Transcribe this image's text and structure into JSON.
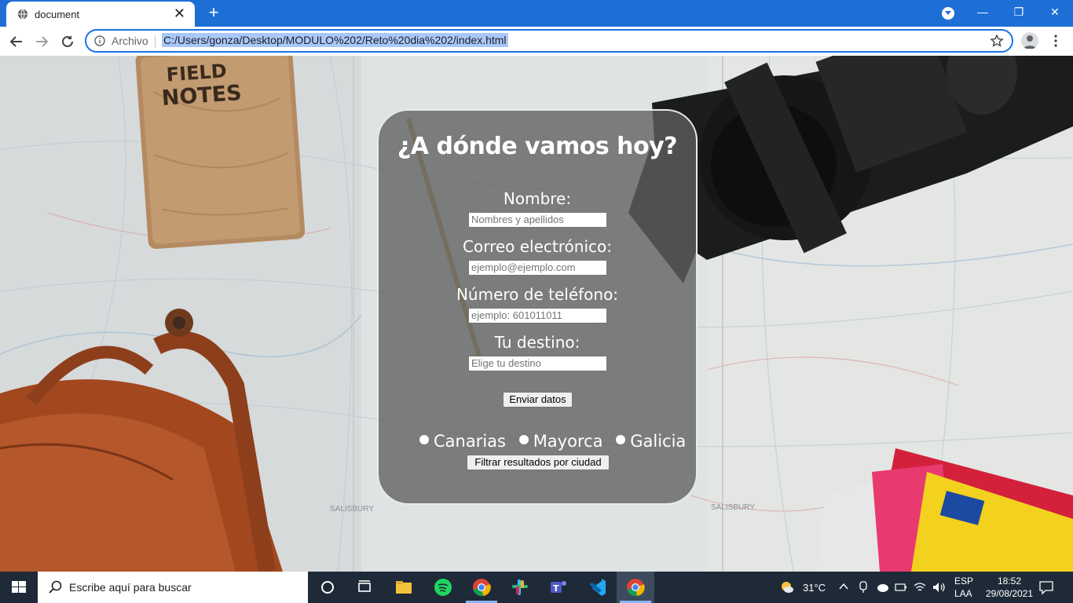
{
  "browser": {
    "tab_title": "document",
    "tab_close": "✕",
    "new_tab": "+",
    "minimize": "—",
    "restore": "❐",
    "close": "✕",
    "scheme_label": "Archivo",
    "url": "C:/Users/gonza/Desktop/MODULO%202/Reto%20dia%202/index.html",
    "accent_color": "#1d6fd6"
  },
  "form": {
    "title": "¿A dónde vamos hoy?",
    "name_label": "Nombre:",
    "name_placeholder": "Nombres y apellidos",
    "email_label": "Correo electrónico:",
    "email_placeholder": "ejemplo@ejemplo.com",
    "phone_label": "Número de teléfono:",
    "phone_placeholder": "ejemplo: 601011011",
    "destination_label": "Tu destino:",
    "destination_placeholder": "Elige tu destino",
    "submit_label": "Enviar datos",
    "cities": [
      "Canarias",
      "Mayorca",
      "Galicia"
    ],
    "filter_label": "Filtrar resultados por ciudad"
  },
  "background": {
    "notebook_line1": "FIELD",
    "notebook_line2": "NOTES",
    "map_label": "SALISBURY"
  },
  "taskbar": {
    "search_placeholder": "Escribe aquí para buscar",
    "weather": "31°C",
    "language": "ESP",
    "layout": "LAA",
    "time": "18:52",
    "date": "29/08/2021"
  }
}
